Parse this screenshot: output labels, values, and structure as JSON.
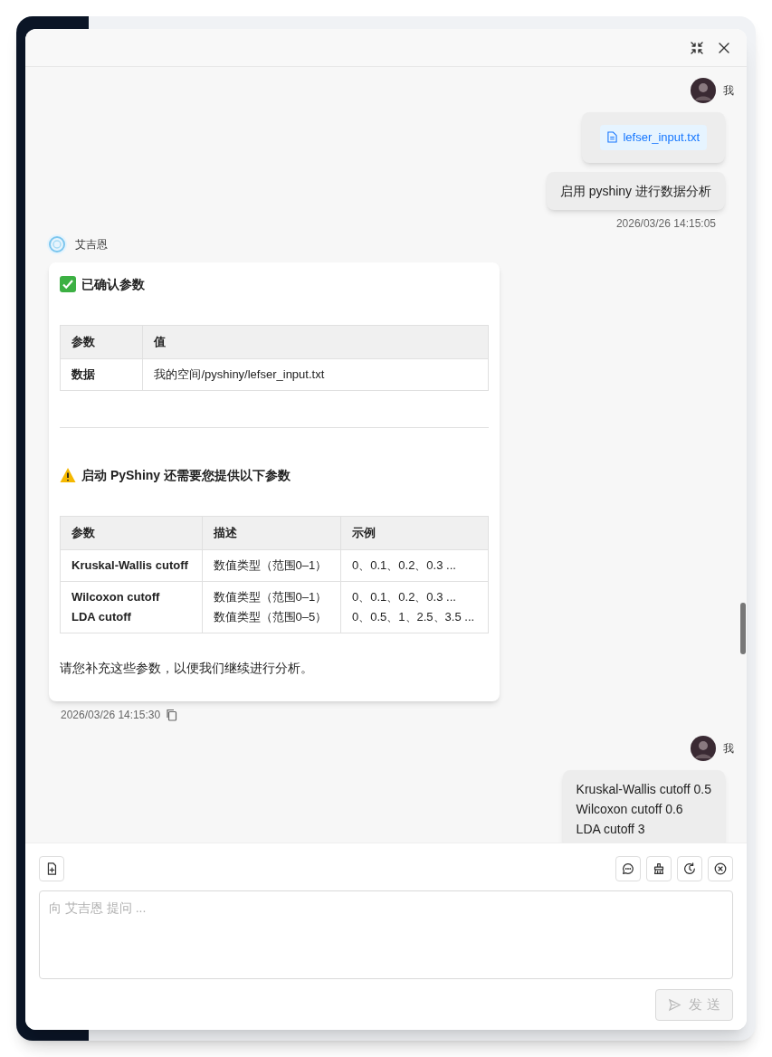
{
  "dialog": {
    "header_buttons": [
      {
        "kind": "collapse"
      },
      {
        "kind": "close"
      }
    ]
  },
  "messages": [
    {
      "kind": "user",
      "author": "我",
      "bubbles": [
        {
          "kind": "file",
          "text": "lefser_input.txt"
        },
        {
          "kind": "text",
          "lines": [
            "启用 pyshiny 进行数据分析"
          ]
        }
      ],
      "time": "2026/03/26 14:15:05"
    },
    {
      "kind": "bot",
      "author": "艾吉恩",
      "blocks": [
        {
          "kind": "confirmed_heading",
          "text": "已确认参数"
        },
        {
          "kind": "table",
          "columns": [
            "参数",
            "值"
          ],
          "rows": [
            [
              [
                "数据"
              ],
              [
                "我的空间/pyshiny/lefser_input.txt"
              ]
            ]
          ]
        },
        {
          "kind": "rule"
        },
        {
          "kind": "warning_heading",
          "text": "启动 PyShiny 还需要您提供以下参数"
        },
        {
          "kind": "table",
          "columns": [
            "参数",
            "描述",
            "示例"
          ],
          "rows": [
            [
              [
                "Kruskal-Wallis cutoff"
              ],
              [
                "数值类型（范围0–1）"
              ],
              [
                "0、0.1、0.2、0.3 ..."
              ]
            ],
            [
              [
                "Wilcoxon cutoff",
                "LDA cutoff"
              ],
              [
                "数值类型（范围0–1）",
                "数值类型（范围0–5）"
              ],
              [
                "0、0.1、0.2、0.3 ...",
                "0、0.5、1、2.5、3.5 ..."
              ]
            ]
          ]
        },
        {
          "kind": "paragraph",
          "text": "请您补充这些参数，以便我们继续进行分析。"
        }
      ],
      "time": "2026/03/26 14:15:30"
    },
    {
      "kind": "user",
      "author": "我",
      "bubbles": [
        {
          "kind": "text",
          "lines": [
            "Kruskal-Wallis cutoff 0.5",
            "Wilcoxon cutoff 0.6",
            "LDA cutoff 3"
          ]
        }
      ]
    }
  ],
  "toolbar": {
    "left": [
      {
        "kind": "attach"
      }
    ],
    "right": [
      {
        "kind": "chat"
      },
      {
        "kind": "clean"
      },
      {
        "kind": "history"
      },
      {
        "kind": "stop"
      }
    ]
  },
  "input": {
    "placeholder": "向 艾吉恩 提问 ..."
  },
  "send_button": {
    "label": "发 送",
    "disabled": true
  }
}
